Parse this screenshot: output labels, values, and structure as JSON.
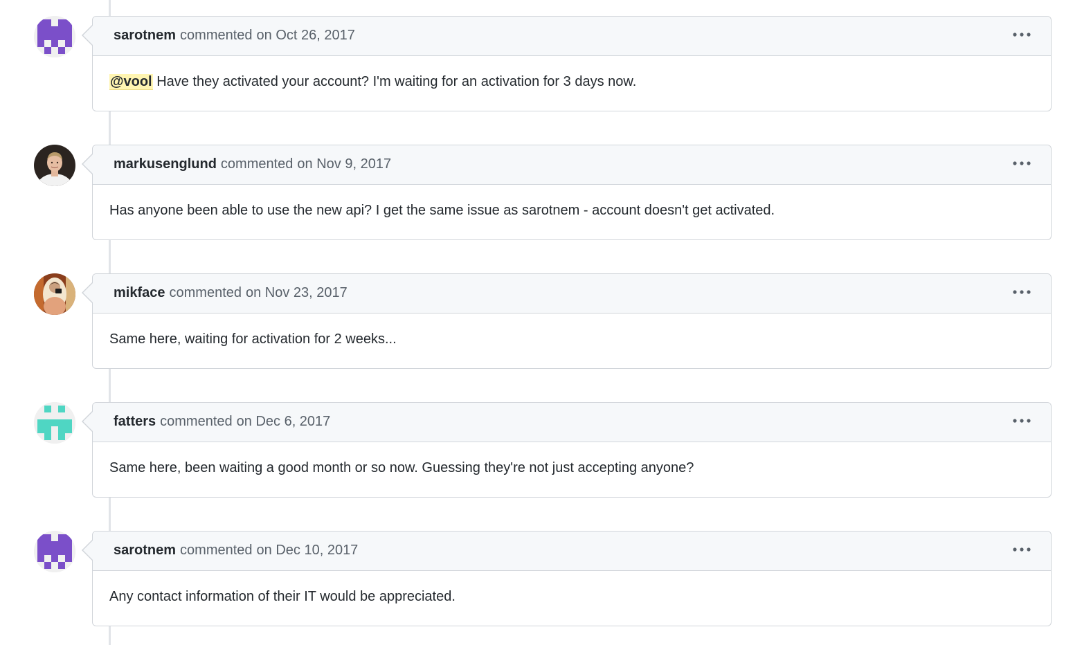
{
  "comments": [
    {
      "author": "sarotnem",
      "meta_prefix": "commented",
      "timestamp": "on Oct 26, 2017",
      "avatar": "identicon-purple",
      "mention": "@vool",
      "body": "Have they activated your account? I'm waiting for an activation for 3 days now."
    },
    {
      "author": "markusenglund",
      "meta_prefix": "commented",
      "timestamp": "on Nov 9, 2017",
      "avatar": "photo-man-white-shirt",
      "body": "Has anyone been able to use the new api? I get the same issue as sarotnem - account doesn't get activated."
    },
    {
      "author": "mikface",
      "meta_prefix": "commented",
      "timestamp": "on Nov 23, 2017",
      "avatar": "photo-mirror-selfie",
      "body": "Same here, waiting for activation for 2 weeks..."
    },
    {
      "author": "fatters",
      "meta_prefix": "commented",
      "timestamp": "on Dec 6, 2017",
      "avatar": "identicon-teal",
      "body": "Same here, been waiting a good month or so now. Guessing they're not just accepting anyone?"
    },
    {
      "author": "sarotnem",
      "meta_prefix": "commented",
      "timestamp": "on Dec 10, 2017",
      "avatar": "identicon-purple",
      "body": "Any contact information of their IT would be appreciated."
    }
  ],
  "colors": {
    "identicon_purple": "#7b4fc9",
    "identicon_teal": "#4fd6c3",
    "header_bg": "#f6f8fa",
    "border": "#d1d5da",
    "mention_bg": "#fff5b1",
    "timeline": "#e1e4e8"
  },
  "icons": {
    "more_actions": "kebab-horizontal-icon"
  }
}
